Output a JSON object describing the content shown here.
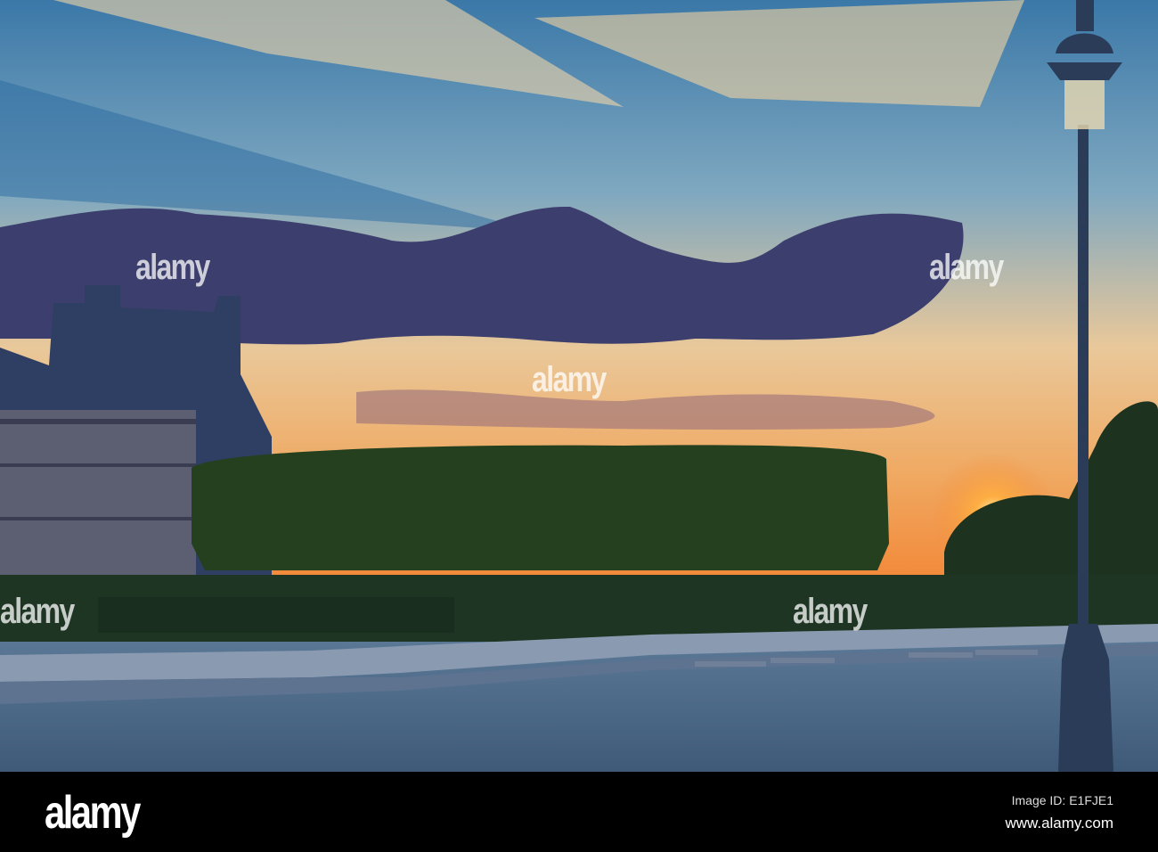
{
  "watermark": {
    "text": "alamy"
  },
  "footer": {
    "logo": "alamy",
    "image_id": "Image ID: E1FJE1",
    "website": "www.alamy.com"
  },
  "colors": {
    "sky_top": "#3b78a8",
    "horizon": "#f2893a",
    "ground": "#4b6682"
  }
}
